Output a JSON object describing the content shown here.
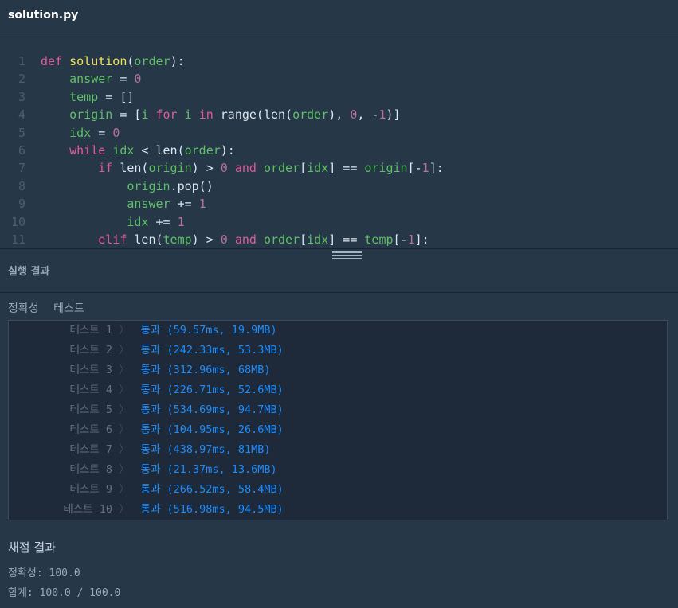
{
  "tab": {
    "title": "solution.py"
  },
  "code": {
    "lines": [
      [
        {
          "t": "def ",
          "c": "kw"
        },
        {
          "t": "solution",
          "c": "fn"
        },
        {
          "t": "(",
          "c": "plain"
        },
        {
          "t": "order",
          "c": "var"
        },
        {
          "t": "):",
          "c": "plain"
        }
      ],
      [
        {
          "t": "    ",
          "c": "plain"
        },
        {
          "t": "answer",
          "c": "var"
        },
        {
          "t": " = ",
          "c": "plain"
        },
        {
          "t": "0",
          "c": "num"
        }
      ],
      [
        {
          "t": "    ",
          "c": "plain"
        },
        {
          "t": "temp",
          "c": "var"
        },
        {
          "t": " = []",
          "c": "plain"
        }
      ],
      [
        {
          "t": "    ",
          "c": "plain"
        },
        {
          "t": "origin",
          "c": "var"
        },
        {
          "t": " = [",
          "c": "plain"
        },
        {
          "t": "i ",
          "c": "var"
        },
        {
          "t": "for ",
          "c": "kw"
        },
        {
          "t": "i ",
          "c": "var"
        },
        {
          "t": "in ",
          "c": "kw"
        },
        {
          "t": "range(len(",
          "c": "plain"
        },
        {
          "t": "order",
          "c": "var"
        },
        {
          "t": "), ",
          "c": "plain"
        },
        {
          "t": "0",
          "c": "num"
        },
        {
          "t": ", -",
          "c": "plain"
        },
        {
          "t": "1",
          "c": "num"
        },
        {
          "t": ")]",
          "c": "plain"
        }
      ],
      [
        {
          "t": "    ",
          "c": "plain"
        },
        {
          "t": "idx",
          "c": "var"
        },
        {
          "t": " = ",
          "c": "plain"
        },
        {
          "t": "0",
          "c": "num"
        }
      ],
      [
        {
          "t": "    ",
          "c": "plain"
        },
        {
          "t": "while ",
          "c": "kw"
        },
        {
          "t": "idx",
          "c": "var"
        },
        {
          "t": " < len(",
          "c": "plain"
        },
        {
          "t": "order",
          "c": "var"
        },
        {
          "t": "):",
          "c": "plain"
        }
      ],
      [
        {
          "t": "        ",
          "c": "plain"
        },
        {
          "t": "if ",
          "c": "kw"
        },
        {
          "t": "len(",
          "c": "plain"
        },
        {
          "t": "origin",
          "c": "var"
        },
        {
          "t": ") > ",
          "c": "plain"
        },
        {
          "t": "0 ",
          "c": "num"
        },
        {
          "t": "and ",
          "c": "kw"
        },
        {
          "t": "order",
          "c": "var"
        },
        {
          "t": "[",
          "c": "plain"
        },
        {
          "t": "idx",
          "c": "var"
        },
        {
          "t": "] == ",
          "c": "plain"
        },
        {
          "t": "origin",
          "c": "var"
        },
        {
          "t": "[-",
          "c": "plain"
        },
        {
          "t": "1",
          "c": "num"
        },
        {
          "t": "]:",
          "c": "plain"
        }
      ],
      [
        {
          "t": "            ",
          "c": "plain"
        },
        {
          "t": "origin",
          "c": "var"
        },
        {
          "t": ".pop()",
          "c": "plain"
        }
      ],
      [
        {
          "t": "            ",
          "c": "plain"
        },
        {
          "t": "answer",
          "c": "var"
        },
        {
          "t": " += ",
          "c": "plain"
        },
        {
          "t": "1",
          "c": "num"
        }
      ],
      [
        {
          "t": "            ",
          "c": "plain"
        },
        {
          "t": "idx",
          "c": "var"
        },
        {
          "t": " += ",
          "c": "plain"
        },
        {
          "t": "1",
          "c": "num"
        }
      ],
      [
        {
          "t": "        ",
          "c": "plain"
        },
        {
          "t": "elif ",
          "c": "kw"
        },
        {
          "t": "len(",
          "c": "plain"
        },
        {
          "t": "temp",
          "c": "var"
        },
        {
          "t": ") > ",
          "c": "plain"
        },
        {
          "t": "0 ",
          "c": "num"
        },
        {
          "t": "and ",
          "c": "kw"
        },
        {
          "t": "order",
          "c": "var"
        },
        {
          "t": "[",
          "c": "plain"
        },
        {
          "t": "idx",
          "c": "var"
        },
        {
          "t": "] == ",
          "c": "plain"
        },
        {
          "t": "temp",
          "c": "var"
        },
        {
          "t": "[-",
          "c": "plain"
        },
        {
          "t": "1",
          "c": "num"
        },
        {
          "t": "]:",
          "c": "plain"
        }
      ]
    ]
  },
  "results": {
    "header": "실행 결과",
    "tabs": [
      "정확성",
      "테스트"
    ],
    "tests": [
      {
        "label": "테스트 1",
        "result": "통과 (59.57ms, 19.9MB)"
      },
      {
        "label": "테스트 2",
        "result": "통과 (242.33ms, 53.3MB)"
      },
      {
        "label": "테스트 3",
        "result": "통과 (312.96ms, 68MB)"
      },
      {
        "label": "테스트 4",
        "result": "통과 (226.71ms, 52.6MB)"
      },
      {
        "label": "테스트 5",
        "result": "통과 (534.69ms, 94.7MB)"
      },
      {
        "label": "테스트 6",
        "result": "통과 (104.95ms, 26.6MB)"
      },
      {
        "label": "테스트 7",
        "result": "통과 (438.97ms, 81MB)"
      },
      {
        "label": "테스트 8",
        "result": "통과 (21.37ms, 13.6MB)"
      },
      {
        "label": "테스트 9",
        "result": "통과 (266.52ms, 58.4MB)"
      },
      {
        "label": "테스트 10",
        "result": "통과 (516.98ms, 94.5MB)"
      }
    ]
  },
  "grading": {
    "title": "채점 결과",
    "accuracy": "정확성: 100.0",
    "total": "합계: 100.0 / 100.0"
  }
}
